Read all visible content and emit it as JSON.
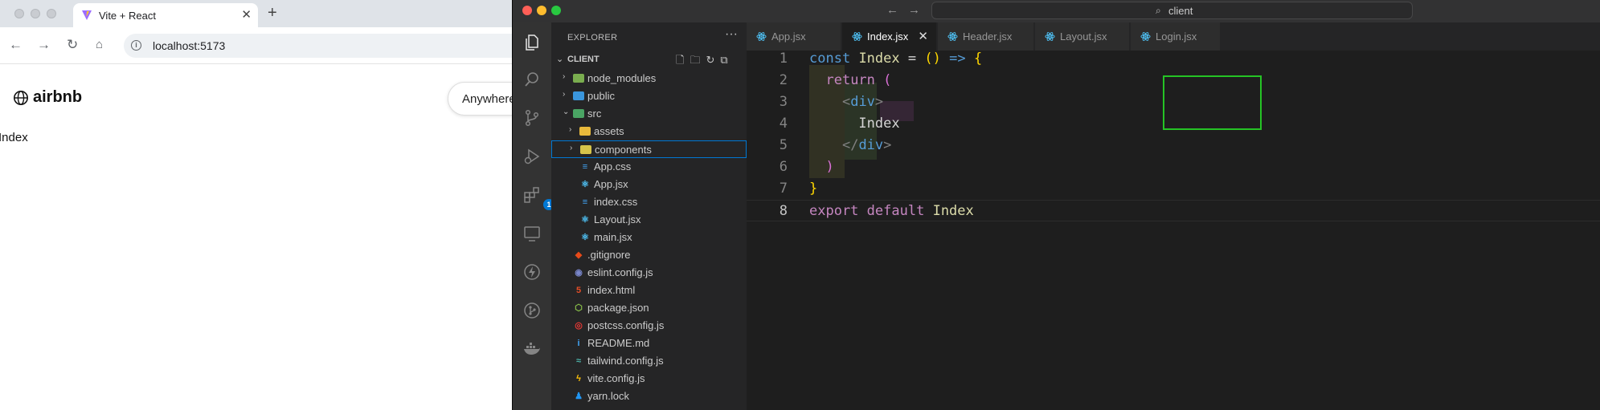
{
  "browser": {
    "tab_title": "Vite + React",
    "tab_close": "✕",
    "new_tab": "+",
    "url": "localhost:5173",
    "logo_text": "airbnb",
    "search_pill_text": "Anywhere",
    "page_text": "Index"
  },
  "vscode": {
    "command_center": "client",
    "explorer_title": "EXPLORER",
    "explorer_more": "···",
    "section_title": "CLIENT",
    "extensions_badge": "1",
    "tree": [
      {
        "name": "node_modules",
        "depth": 1,
        "type": "folder",
        "icon_color": "#7aad4f",
        "collapsed": true
      },
      {
        "name": "public",
        "depth": 1,
        "type": "folder",
        "icon_color": "#3a96dd",
        "collapsed": true
      },
      {
        "name": "src",
        "depth": 1,
        "type": "folder-open",
        "icon_color": "#4aa564",
        "collapsed": false
      },
      {
        "name": "assets",
        "depth": 2,
        "type": "folder",
        "icon_color": "#e8b93b",
        "collapsed": true
      },
      {
        "name": "components",
        "depth": 2,
        "type": "folder",
        "icon_color": "#d6c44a",
        "collapsed": true,
        "selected": true
      },
      {
        "name": "App.css",
        "depth": 2,
        "type": "css",
        "icon_color": "#42a5f5"
      },
      {
        "name": "App.jsx",
        "depth": 2,
        "type": "react",
        "icon_color": "#4fc3f7"
      },
      {
        "name": "index.css",
        "depth": 2,
        "type": "css",
        "icon_color": "#42a5f5"
      },
      {
        "name": "Layout.jsx",
        "depth": 2,
        "type": "react",
        "icon_color": "#4fc3f7"
      },
      {
        "name": "main.jsx",
        "depth": 2,
        "type": "react",
        "icon_color": "#4fc3f7"
      },
      {
        "name": ".gitignore",
        "depth": 1,
        "type": "git",
        "icon_color": "#e64a19"
      },
      {
        "name": "eslint.config.js",
        "depth": 1,
        "type": "eslint",
        "icon_color": "#7986cb"
      },
      {
        "name": "index.html",
        "depth": 1,
        "type": "html",
        "icon_color": "#e44d26"
      },
      {
        "name": "package.json",
        "depth": 1,
        "type": "npm",
        "icon_color": "#8bc34a"
      },
      {
        "name": "postcss.config.js",
        "depth": 1,
        "type": "postcss",
        "icon_color": "#e53935"
      },
      {
        "name": "README.md",
        "depth": 1,
        "type": "info",
        "icon_color": "#42a5f5"
      },
      {
        "name": "tailwind.config.js",
        "depth": 1,
        "type": "tailwind",
        "icon_color": "#4db6ac"
      },
      {
        "name": "vite.config.js",
        "depth": 1,
        "type": "vite",
        "icon_color": "#ffc107"
      },
      {
        "name": "yarn.lock",
        "depth": 1,
        "type": "yarn",
        "icon_color": "#2196f3"
      }
    ],
    "tabs": [
      {
        "label": "App.jsx",
        "active": false
      },
      {
        "label": "Index.jsx",
        "active": true,
        "close": "✕"
      },
      {
        "label": "Header.jsx",
        "active": false
      },
      {
        "label": "Layout.jsx",
        "active": false
      },
      {
        "label": "Login.jsx",
        "active": false
      }
    ],
    "line_numbers": [
      "1",
      "2",
      "3",
      "4",
      "5",
      "6",
      "7",
      "8"
    ],
    "code": {
      "l1": {
        "kw": "const",
        "name": "Index",
        "eq": "=",
        "open": "()",
        "arrow": "=>",
        "brace": "{"
      },
      "l2": {
        "kw": "return",
        "paren": "("
      },
      "l3": {
        "lt": "<",
        "tag": "div",
        "gt": ">"
      },
      "l4": {
        "text": "Index"
      },
      "l5": {
        "lt": "</",
        "tag": "div",
        "gt": ">"
      },
      "l6": {
        "paren": ")"
      },
      "l7": {
        "brace": "}"
      },
      "l8": {
        "kw1": "export",
        "kw2": "default",
        "name": "Index"
      }
    }
  }
}
